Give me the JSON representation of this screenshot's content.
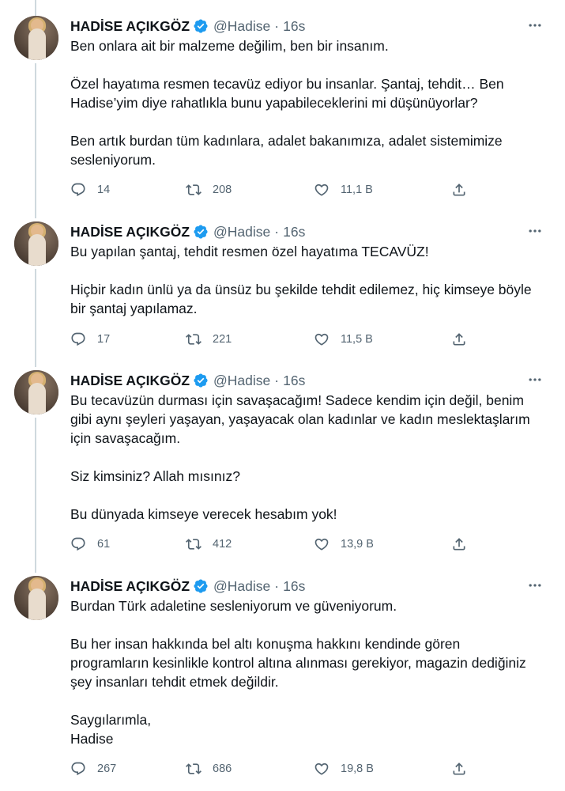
{
  "tweets": [
    {
      "author": {
        "name": "HADİSE AÇIKGÖZ",
        "handle": "@Hadise",
        "time": "16s"
      },
      "lines": [
        "Ben onlara ait bir malzeme değilim, ben bir insanım.",
        "",
        "Özel hayatıma resmen tecavüz ediyor bu insanlar. Şantaj, tehdit… Ben",
        "Hadise’yim diye rahatlıkla bunu yapabileceklerini mi düşünüyorlar?",
        "",
        "Ben artık burdan tüm kadınlara, adalet bakanımıza, adalet sistemimize",
        "sesleniyorum."
      ],
      "replies": "14",
      "retweets": "208",
      "likes": "11,1 B"
    },
    {
      "author": {
        "name": "HADİSE AÇIKGÖZ",
        "handle": "@Hadise",
        "time": "16s"
      },
      "lines": [
        "Bu yapılan şantaj, tehdit resmen özel hayatıma TECAVÜZ!",
        "",
        "Hiçbir kadın ünlü ya da ünsüz bu şekilde tehdit edilemez, hiç kimseye böyle",
        "bir şantaj yapılamaz."
      ],
      "replies": "17",
      "retweets": "221",
      "likes": "11,5 B"
    },
    {
      "author": {
        "name": "HADİSE AÇIKGÖZ",
        "handle": "@Hadise",
        "time": "16s"
      },
      "lines": [
        "Bu tecavüzün durması için savaşacağım! Sadece kendim için değil, benim",
        "gibi aynı şeyleri yaşayan, yaşayacak olan kadınlar ve kadın meslektaşlarım",
        "için savaşacağım.",
        "",
        "Siz kimsiniz? Allah mısınız?",
        "",
        "Bu dünyada kimseye verecek hesabım yok!"
      ],
      "replies": "61",
      "retweets": "412",
      "likes": "13,9 B"
    },
    {
      "author": {
        "name": "HADİSE AÇIKGÖZ",
        "handle": "@Hadise",
        "time": "16s"
      },
      "lines": [
        "Burdan Türk adaletine sesleniyorum ve güveniyorum.",
        "",
        "Bu her insan hakkında bel altı konuşma hakkını kendinde gören",
        "programların kesinlikle kontrol altına alınması gerekiyor, magazin dediğiniz",
        "şey insanları tehdit etmek değildir.",
        "",
        "Saygılarımla,",
        "Hadise"
      ],
      "replies": "267",
      "retweets": "686",
      "likes": "19,8 B"
    }
  ],
  "icons": {
    "verified": "verified-badge-icon",
    "more": "more-options-icon",
    "reply": "reply-icon",
    "retweet": "retweet-icon",
    "like": "heart-icon",
    "share": "share-icon"
  },
  "colors": {
    "verified": "#1d9bf0",
    "secondary": "#536471",
    "text": "#0f1419",
    "thread_line": "#cfd9de"
  }
}
